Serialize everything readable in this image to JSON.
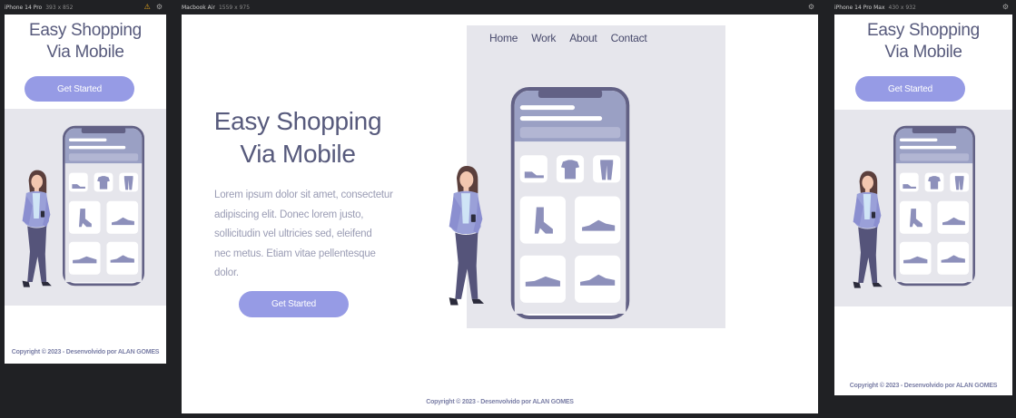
{
  "devices": [
    {
      "name": "iPhone 14 Pro",
      "size": "393 x 852"
    },
    {
      "name": "Macbook Air",
      "size": "1559 x 975"
    },
    {
      "name": "iPhone 14 Pro Max",
      "size": "430 x 932"
    }
  ],
  "hero": {
    "title_line1": "Easy Shopping",
    "title_line2": "Via Mobile",
    "cta_label": "Get Started",
    "description_lines": [
      "Lorem ipsum dolor sit amet, consectetur",
      "adipiscing elit. Donec lorem justo,",
      "sollicitudin vel ultricies sed, eleifend",
      "nec metus. Etiam vitae pellentesque",
      "dolor."
    ]
  },
  "nav": {
    "items": [
      "Home",
      "Work",
      "About",
      "Contact"
    ]
  },
  "footer": {
    "copyright": "Copyright © 2023 - Desenvolvido por ALAN GOMES"
  },
  "colors": {
    "accent": "#969be5",
    "text_dark": "#575a7c",
    "panel_grey": "#e6e6ec",
    "phone_frame": "#626185",
    "phone_header": "#9aa0c4",
    "icon": "#8d90bb"
  },
  "icons": [
    "warning-icon",
    "gear-icon",
    "shoe-icon",
    "tshirt-icon",
    "pants-icon",
    "boot-icon",
    "sneaker-icon"
  ]
}
